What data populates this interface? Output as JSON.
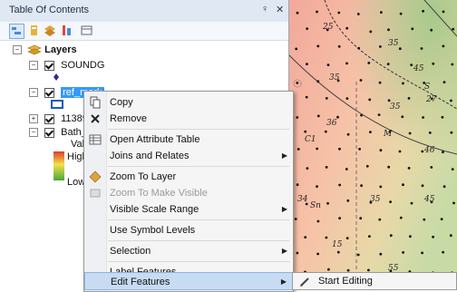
{
  "toc": {
    "title": "Table Of Contents",
    "pin": "♀",
    "close": "✕",
    "tree": {
      "layers": "Layers",
      "soundg": "SOUNDG",
      "ref_mark": "ref_mark",
      "layer_11389": "11389_",
      "bath": "Bath_a",
      "val": "Val",
      "high": "High",
      "low": "Low"
    }
  },
  "menu": {
    "items": [
      {
        "label": "Copy"
      },
      {
        "label": "Remove"
      },
      {
        "label": "Open Attribute Table"
      },
      {
        "label": "Joins and Relates"
      },
      {
        "label": "Zoom To Layer"
      },
      {
        "label": "Zoom To Make Visible"
      },
      {
        "label": "Visible Scale Range"
      },
      {
        "label": "Use Symbol Levels"
      },
      {
        "label": "Selection"
      },
      {
        "label": "Label Features"
      },
      {
        "label": "Edit Features"
      }
    ],
    "submenu": {
      "label": "Start Editing"
    }
  },
  "map": {
    "labels": [
      "25",
      "35",
      "45",
      "S",
      "27",
      "35",
      "36",
      "C1",
      "46",
      "M",
      "35",
      "45",
      "34",
      "Sn",
      "35",
      "15",
      "55"
    ]
  }
}
